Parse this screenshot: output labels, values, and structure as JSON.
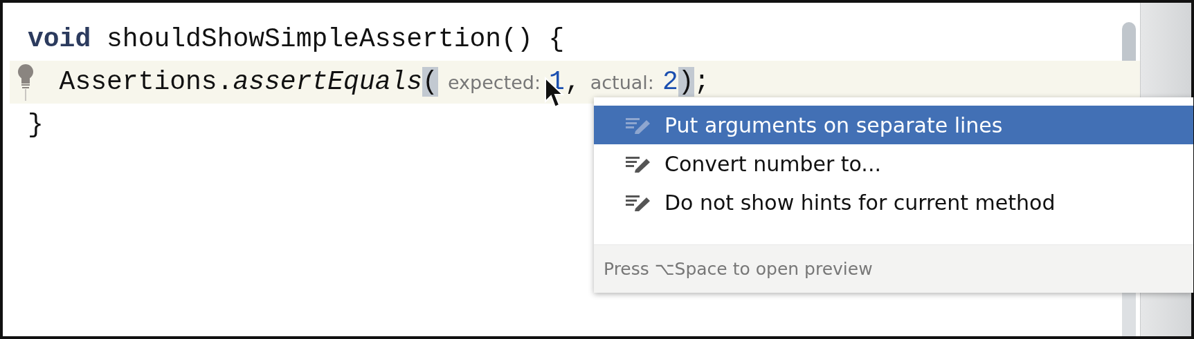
{
  "code_lines": [
    {
      "current": false,
      "bulb": false,
      "tokens": [
        {
          "kind": "keyword",
          "text": "void"
        },
        {
          "kind": "plain",
          "text": " shouldShowSimpleAssertion() {"
        }
      ]
    },
    {
      "current": true,
      "bulb": true,
      "tokens": [
        {
          "kind": "plain",
          "text": "  Assertions."
        },
        {
          "kind": "method",
          "text": "assertEquals"
        },
        {
          "kind": "brace_match",
          "text": "("
        },
        {
          "kind": "hint",
          "text": "expected:"
        },
        {
          "kind": "number",
          "text": "1"
        },
        {
          "kind": "plain",
          "text": ","
        },
        {
          "kind": "hint",
          "text": "actual:"
        },
        {
          "kind": "number",
          "text": "2"
        },
        {
          "kind": "brace_match",
          "text": ")"
        },
        {
          "kind": "plain",
          "text": ";"
        }
      ]
    },
    {
      "current": false,
      "bulb": false,
      "tokens": [
        {
          "kind": "plain",
          "text": "}"
        }
      ]
    }
  ],
  "popup": {
    "items": [
      {
        "label": "Put arguments on separate lines",
        "selected": true
      },
      {
        "label": "Convert number to...",
        "selected": false
      },
      {
        "label": "Do not show hints for current method",
        "selected": false
      }
    ],
    "footer": "Press ⌥Space to open preview"
  }
}
